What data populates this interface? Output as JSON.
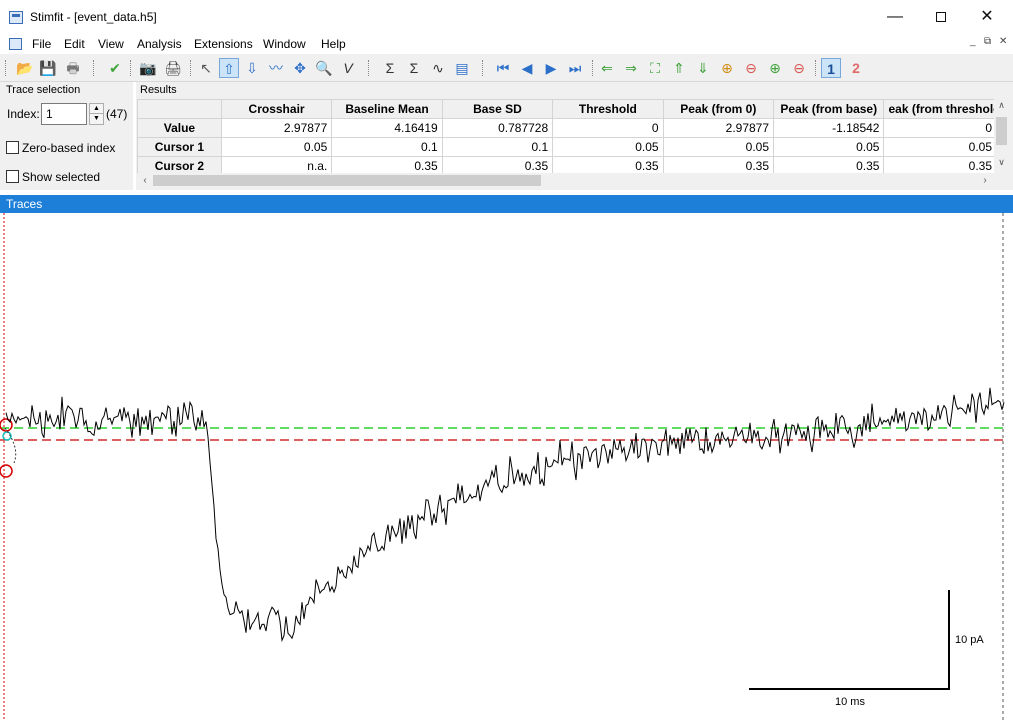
{
  "window": {
    "title": "Stimfit - [event_data.h5]",
    "minimize": "—",
    "close": "✕"
  },
  "menu": {
    "items": [
      "File",
      "Edit",
      "View",
      "Analysis",
      "Extensions",
      "Window",
      "Help"
    ],
    "mdi_buttons": [
      "_",
      "⧉",
      "✕"
    ]
  },
  "toolbar": {
    "buttons": [
      {
        "name": "open-icon",
        "glyph": "📂"
      },
      {
        "name": "save-icon",
        "glyph": "💾"
      },
      {
        "name": "print-icon",
        "glyph": "🖶"
      },
      {
        "name": "apply-icon",
        "glyph": "✔"
      },
      {
        "name": "camera-icon",
        "glyph": "📷"
      },
      {
        "name": "export-ps-icon",
        "glyph": "🖨"
      },
      {
        "name": "select-arrow-icon",
        "glyph": "↖"
      },
      {
        "name": "trace-up-icon",
        "glyph": "⇧"
      },
      {
        "name": "trace-down-icon",
        "glyph": "⇩"
      },
      {
        "name": "fit-icon",
        "glyph": "〰"
      },
      {
        "name": "pan-icon",
        "glyph": "✥"
      },
      {
        "name": "zoom-icon",
        "glyph": "🔍"
      },
      {
        "name": "event-icon",
        "glyph": "V"
      },
      {
        "name": "sum-icon",
        "glyph": "Σ"
      },
      {
        "name": "sum-all-icon",
        "glyph": "Σ"
      },
      {
        "name": "wave-icon",
        "glyph": "∿"
      },
      {
        "name": "table-icon",
        "glyph": "▤"
      },
      {
        "name": "first-icon",
        "glyph": "⏮"
      },
      {
        "name": "previous-icon",
        "glyph": "◀"
      },
      {
        "name": "next-icon",
        "glyph": "▶"
      },
      {
        "name": "last-icon",
        "glyph": "⏭"
      },
      {
        "name": "arrow-left-icon",
        "glyph": "⇐"
      },
      {
        "name": "arrow-right-icon",
        "glyph": "⇒"
      },
      {
        "name": "fit-window-icon",
        "glyph": "⛶"
      },
      {
        "name": "arrow-up-icon",
        "glyph": "⇑"
      },
      {
        "name": "arrow-down-icon",
        "glyph": "⇓"
      },
      {
        "name": "zoom-in-x-icon",
        "glyph": "⊕"
      },
      {
        "name": "zoom-out-x-icon",
        "glyph": "⊖"
      },
      {
        "name": "zoom-in-y-icon",
        "glyph": "⊕"
      },
      {
        "name": "zoom-out-y-icon",
        "glyph": "⊖"
      },
      {
        "name": "channel-1-icon",
        "glyph": "1"
      },
      {
        "name": "channel-2-icon",
        "glyph": "2"
      }
    ]
  },
  "trace_selection": {
    "title": "Trace selection",
    "index_label": "Index:",
    "index_value": "1",
    "index_count": "(47)",
    "zero_based": "Zero-based index",
    "show_selected": "Show selected"
  },
  "results": {
    "title": "Results",
    "columns": [
      "Crosshair",
      "Baseline Mean",
      "Base SD",
      "Threshold",
      "Peak (from 0)",
      "Peak (from base)",
      "eak (from thresholc"
    ],
    "rows": [
      {
        "label": "Value",
        "cells": [
          "2.97877",
          "4.16419",
          "0.787728",
          "0",
          "2.97877",
          "-1.18542",
          "0"
        ]
      },
      {
        "label": "Cursor 1",
        "cells": [
          "0.05",
          "0.1",
          "0.1",
          "0.05",
          "0.05",
          "0.05",
          "0.05"
        ]
      },
      {
        "label": "Cursor 2",
        "cells": [
          "n.a.",
          "0.35",
          "0.35",
          "0.35",
          "0.35",
          "0.35",
          "0.35"
        ]
      }
    ]
  },
  "traces": {
    "title": "Traces",
    "scale_y": "10 pA",
    "scale_x": "10 ms"
  },
  "colors": {
    "accent": "#1e7fd9",
    "baseline": "#00c800",
    "threshold": "#c80000",
    "cursor": "#d40000"
  }
}
